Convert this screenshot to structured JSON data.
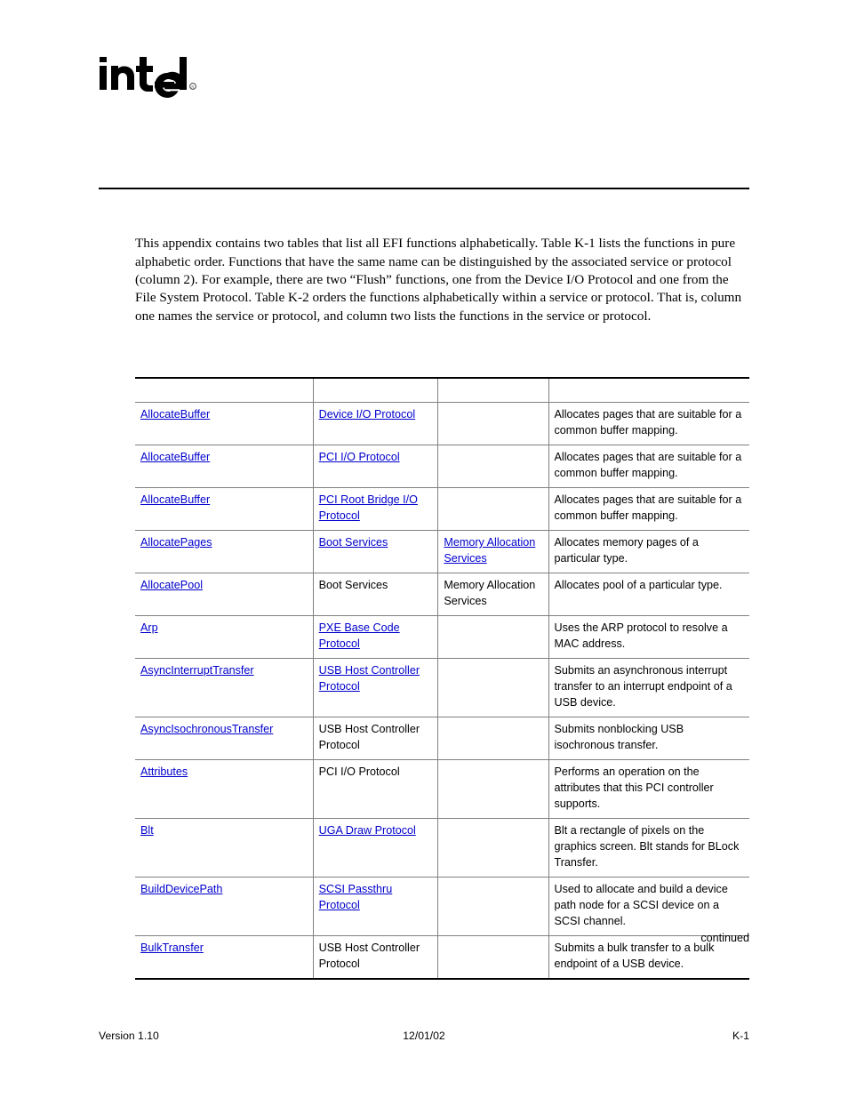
{
  "logo": {
    "brand": "intel",
    "registered_mark": "®"
  },
  "intro": {
    "paragraph": "This appendix contains two tables that list all EFI functions alphabetically.  Table K-1 lists the functions in pure alphabetic order.  Functions that have the same name can be distinguished by the associated service or protocol (column 2).  For example, there are two “Flush” functions, one from the Device I/O Protocol and one from the File System Protocol.  Table K-2 orders the functions alphabetically within a service or protocol.  That is, column one names the service or protocol, and column two lists the functions in the service or protocol."
  },
  "table": {
    "headers": [
      "",
      "",
      "",
      ""
    ],
    "rows": [
      {
        "function": "AllocateBuffer",
        "function_link": true,
        "service": "Device I/O Protocol",
        "service_link": true,
        "subservice": "",
        "subservice_link": false,
        "description": "Allocates pages that are suitable for a common buffer mapping."
      },
      {
        "function": "AllocateBuffer",
        "function_link": true,
        "service": "PCI I/O Protocol",
        "service_link": true,
        "subservice": "",
        "subservice_link": false,
        "description": "Allocates pages that are suitable for a common buffer mapping."
      },
      {
        "function": "AllocateBuffer",
        "function_link": true,
        "service": "PCI Root Bridge I/O Protocol",
        "service_link": true,
        "subservice": "",
        "subservice_link": false,
        "description": "Allocates pages that are suitable for a common buffer mapping."
      },
      {
        "function": "AllocatePages",
        "function_link": true,
        "service": "Boot Services",
        "service_link": true,
        "subservice": "Memory Allocation Services",
        "subservice_link": true,
        "description": "Allocates memory pages of a particular type."
      },
      {
        "function": "AllocatePool",
        "function_link": true,
        "service": "Boot Services",
        "service_link": false,
        "subservice": "Memory Allocation Services",
        "subservice_link": false,
        "description": "Allocates pool of a particular type."
      },
      {
        "function": "Arp",
        "function_link": true,
        "service": "PXE Base Code Protocol",
        "service_link": true,
        "subservice": "",
        "subservice_link": false,
        "description": "Uses the ARP protocol to resolve a MAC address."
      },
      {
        "function": "AsyncInterruptTransfer",
        "function_link": true,
        "service": "USB Host Controller Protocol",
        "service_link": true,
        "subservice": "",
        "subservice_link": false,
        "description": "Submits an asynchronous interrupt transfer to an interrupt endpoint of a USB device."
      },
      {
        "function": "AsyncIsochronousTransfer",
        "function_link": true,
        "service": "USB Host Controller Protocol",
        "service_link": false,
        "subservice": "",
        "subservice_link": false,
        "description": "Submits nonblocking USB isochronous transfer."
      },
      {
        "function": "Attributes",
        "function_link": true,
        "service": "PCI I/O Protocol",
        "service_link": false,
        "subservice": "",
        "subservice_link": false,
        "description": "Performs an operation on the attributes that this PCI controller supports."
      },
      {
        "function": "Blt",
        "function_link": true,
        "service": "UGA Draw Protocol",
        "service_link": true,
        "subservice": "",
        "subservice_link": false,
        "description": "Blt a rectangle of pixels on the graphics screen. Blt stands for BLock Transfer."
      },
      {
        "function": "BuildDevicePath",
        "function_link": true,
        "service": "SCSI Passthru Protocol",
        "service_link": true,
        "subservice": "",
        "subservice_link": false,
        "description": "Used to allocate and build a device path node for a SCSI device on a SCSI channel."
      },
      {
        "function": "BulkTransfer",
        "function_link": true,
        "service": "USB Host Controller Protocol",
        "service_link": false,
        "subservice": "",
        "subservice_link": false,
        "description": "Submits a bulk transfer to a bulk endpoint of a USB device."
      }
    ]
  },
  "continued_note": "continued",
  "footer": {
    "version": "Version 1.10",
    "date": "12/01/02",
    "page": "K-1"
  },
  "colors": {
    "link": "#0000cc",
    "text": "#000000",
    "rule": "#000000",
    "cell_border": "#808080"
  }
}
